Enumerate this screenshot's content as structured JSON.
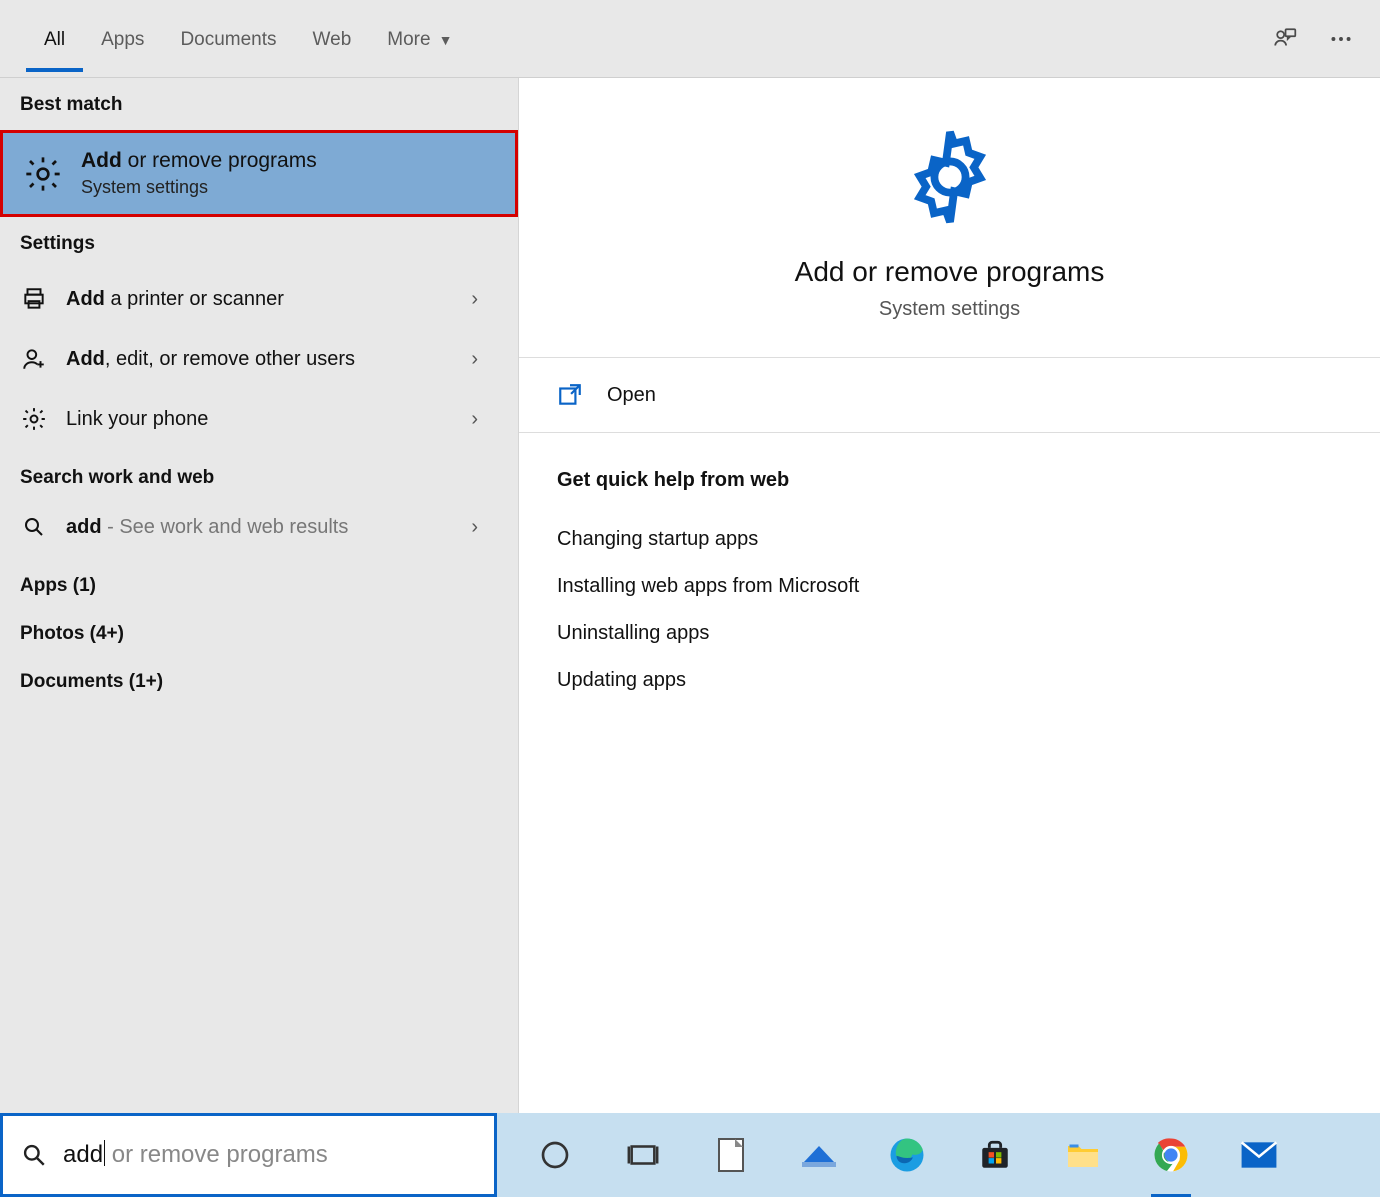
{
  "tabs": {
    "all": "All",
    "apps": "Apps",
    "documents": "Documents",
    "web": "Web",
    "more": "More"
  },
  "left": {
    "best_match_header": "Best match",
    "best_match": {
      "title_bold": "Add",
      "title_rest": " or remove programs",
      "subtitle": "System settings"
    },
    "settings_header": "Settings",
    "settings_items": [
      {
        "bold": "Add",
        "rest": " a printer or scanner"
      },
      {
        "bold": "Add",
        "rest": ", edit, or remove other users"
      },
      {
        "bold": "",
        "rest": "Link your phone"
      }
    ],
    "search_web_header": "Search work and web",
    "search_web_item": {
      "bold": "add",
      "muted": " - See work and web results"
    },
    "counts": {
      "apps": "Apps (1)",
      "photos": "Photos (4+)",
      "documents": "Documents (1+)"
    }
  },
  "right": {
    "title": "Add or remove programs",
    "subtitle": "System settings",
    "open": "Open",
    "help_header": "Get quick help from web",
    "help_links": [
      "Changing startup apps",
      "Installing web apps from Microsoft",
      "Uninstalling apps",
      "Updating apps"
    ]
  },
  "search": {
    "value": "add",
    "ghost_suffix": " or remove programs"
  },
  "colors": {
    "accent": "#0a64c7",
    "highlight_border": "#d40000",
    "selected_bg": "#7eaad4"
  }
}
